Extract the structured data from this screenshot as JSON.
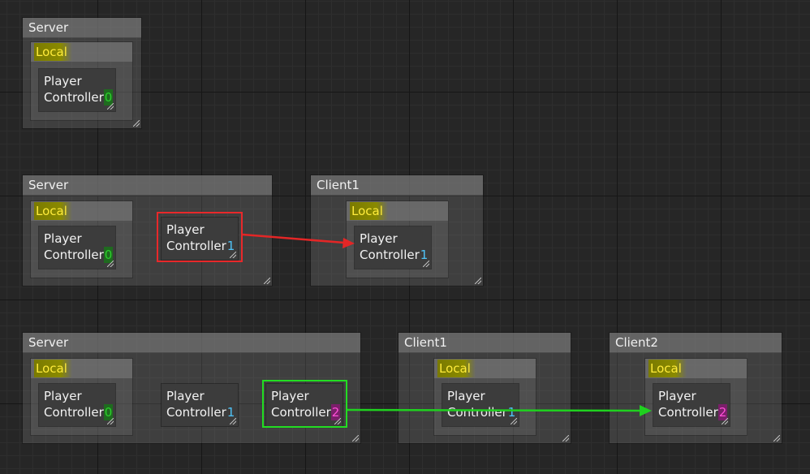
{
  "rows": [
    {
      "server": {
        "title": "Server",
        "local_label": "Local",
        "controllers": [
          {
            "label_line1": "Player",
            "label_line2": "Controller",
            "index": "0",
            "index_color": "#2bd12b",
            "index_bg": "#1f6b1f"
          }
        ]
      },
      "clients": []
    },
    {
      "server": {
        "title": "Server",
        "local_label": "Local",
        "controllers": [
          {
            "label_line1": "Player",
            "label_line2": "Controller",
            "index": "0",
            "index_color": "#2bd12b",
            "index_bg": "#1f6b1f"
          },
          {
            "label_line1": "Player",
            "label_line2": "Controller",
            "index": "1",
            "index_color": "#4fc3f7",
            "index_bg": "",
            "selected": "red"
          }
        ]
      },
      "clients": [
        {
          "title": "Client1",
          "local_label": "Local",
          "controller": {
            "label_line1": "Player",
            "label_line2": "Controller",
            "index": "1",
            "index_color": "#4fc3f7",
            "index_bg": ""
          }
        }
      ]
    },
    {
      "server": {
        "title": "Server",
        "local_label": "Local",
        "controllers": [
          {
            "label_line1": "Player",
            "label_line2": "Controller",
            "index": "0",
            "index_color": "#2bd12b",
            "index_bg": "#1f6b1f"
          },
          {
            "label_line1": "Player",
            "label_line2": "Controller",
            "index": "1",
            "index_color": "#4fc3f7",
            "index_bg": ""
          },
          {
            "label_line1": "Player",
            "label_line2": "Controller",
            "index": "2",
            "index_color": "#ff4fd8",
            "index_bg": "#7a1f6a",
            "selected": "green"
          }
        ]
      },
      "clients": [
        {
          "title": "Client1",
          "local_label": "Local",
          "controller": {
            "label_line1": "Player",
            "label_line2": "Controller",
            "index": "1",
            "index_color": "#4fc3f7",
            "index_bg": ""
          }
        },
        {
          "title": "Client2",
          "local_label": "Local",
          "controller": {
            "label_line1": "Player",
            "label_line2": "Controller",
            "index": "2",
            "index_color": "#ff4fd8",
            "index_bg": "#7a1f6a"
          }
        }
      ]
    }
  ],
  "colors": {
    "replication_arrow_1": "#e32626",
    "replication_arrow_2": "#1fd11f"
  }
}
